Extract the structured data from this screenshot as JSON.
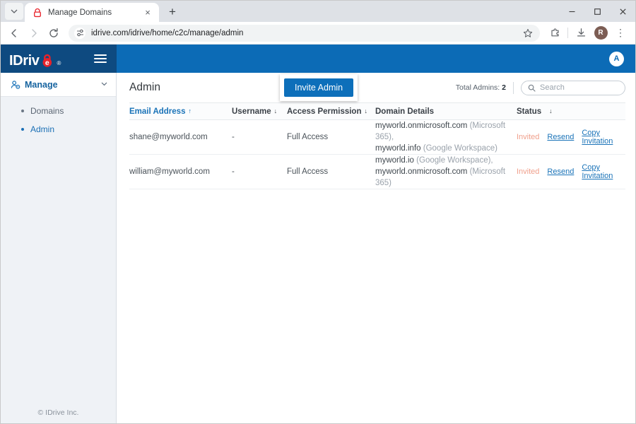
{
  "browser": {
    "tab": {
      "title": "Manage Domains",
      "favicon": "lock-icon",
      "close": "×"
    },
    "new_tab_label": "+",
    "tab_list_chevron": "⌄",
    "window_controls": {
      "minimize": "−",
      "maximize": "□",
      "close": "✕"
    },
    "nav": {
      "back": "←",
      "forward": "→",
      "reload": "⟳"
    },
    "omnibox": {
      "url": "idrive.com/idrive/home/c2c/manage/admin",
      "site_icon": "tune-icon",
      "star_icon": "star-icon"
    },
    "toolbar_icons": [
      "extensions-icon",
      "download-icon"
    ],
    "profile_initial": "R",
    "menu_icon": "⋮"
  },
  "topbar": {
    "logo": {
      "text_before": "IDriv",
      "letter": "e",
      "registered": "®"
    },
    "menu_icon": "hamburger-icon",
    "avatar_initial": "A"
  },
  "sidebar": {
    "manage": {
      "label": "Manage",
      "icon": "users-gear-icon",
      "chevron": "∨"
    },
    "items": [
      {
        "label": "Domains",
        "selected": false
      },
      {
        "label": "Admin",
        "selected": true
      }
    ],
    "footer": "© IDrive Inc."
  },
  "main": {
    "title": "Admin",
    "invite_button": "Invite Admin",
    "total_admins_label": "Total Admins:",
    "total_admins_value": "2",
    "search": {
      "placeholder": "Search",
      "icon": "search-icon"
    },
    "columns": [
      {
        "label": "Email Address",
        "sort": "↑",
        "active": true
      },
      {
        "label": "Username",
        "sort": "↓",
        "active": false
      },
      {
        "label": "Access Permission",
        "sort": "↓",
        "active": false
      },
      {
        "label": "Domain Details",
        "sort": "",
        "active": false
      },
      {
        "label": "Status",
        "sort": "↓",
        "active": false
      }
    ],
    "rows": [
      {
        "email": "shane@myworld.com",
        "username": "-",
        "permission": "Full Access",
        "domains": [
          {
            "name": "myworld.onmicrosoft.com",
            "provider": "(Microsoft 365),",
            "name2": "",
            "provider2": ""
          },
          {
            "name": "myworld.info",
            "provider": "(Google Workspace)"
          }
        ],
        "status": "Invited",
        "actions": [
          "Resend",
          "Copy Invitation"
        ]
      },
      {
        "email": "william@myworld.com",
        "username": "-",
        "permission": "Full Access",
        "domains": [
          {
            "name": "myworld.io",
            "provider": "(Google Workspace),"
          },
          {
            "name": "myworld.onmicrosoft.com",
            "provider": "(Microsoft 365)"
          }
        ],
        "status": "Invited",
        "actions": [
          "Resend",
          "Copy Invitation"
        ]
      }
    ]
  },
  "colors": {
    "brand_navy": "#0e4a80",
    "brand_blue": "#0c6bb6",
    "accent_link": "#1a73b8",
    "status_invited": "#f0a08c",
    "logo_red": "#e8222a"
  }
}
